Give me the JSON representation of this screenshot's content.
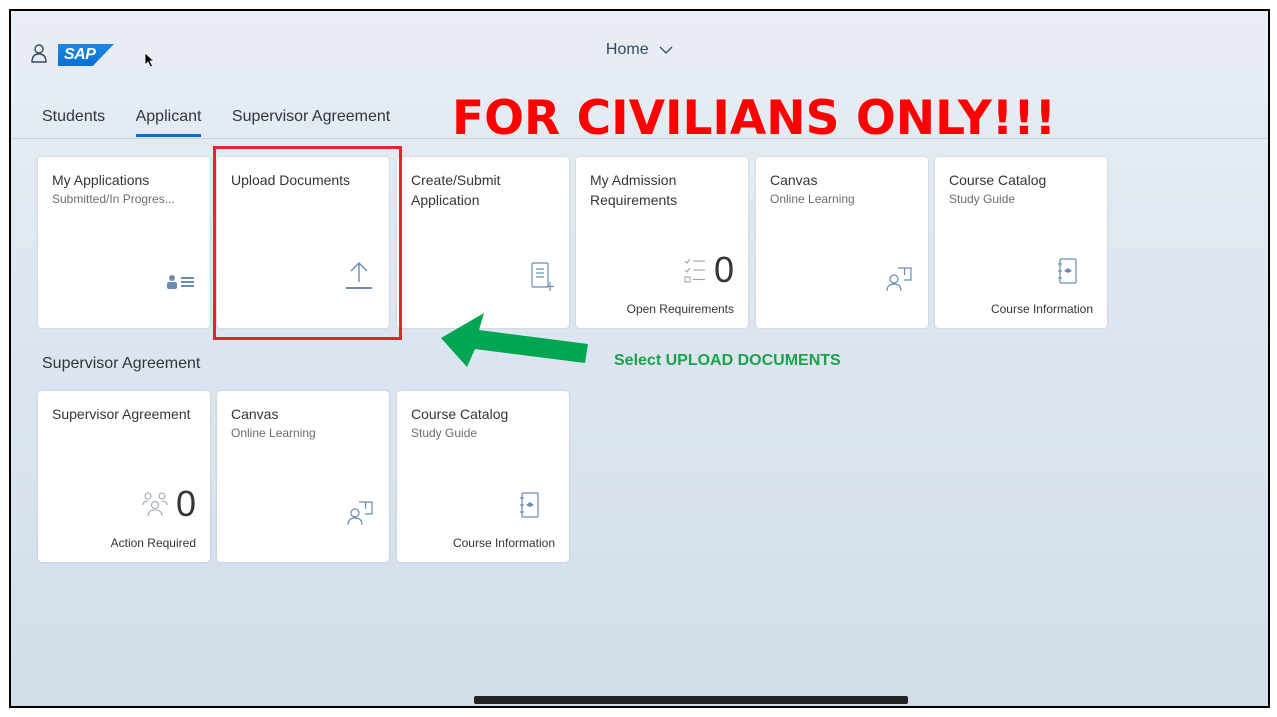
{
  "shell": {
    "home_label": "Home",
    "logo_text": "SAP"
  },
  "tabs": [
    {
      "label": "Students",
      "active": false
    },
    {
      "label": "Applicant",
      "active": true
    },
    {
      "label": "Supervisor Agreement",
      "active": false
    }
  ],
  "banner": {
    "text": "FOR CIVILIANS ONLY!!!",
    "color": "#ff0000"
  },
  "applicant_tiles": [
    {
      "title": "My Applications",
      "subtitle": "Submitted/In Progres...",
      "icon": "applicant-icon"
    },
    {
      "title": "Upload Documents",
      "subtitle": "",
      "icon": "upload-icon"
    },
    {
      "title": "Create/Submit Application",
      "subtitle": "",
      "icon": "add-document-icon"
    },
    {
      "title": "My Admission Requirements",
      "subtitle": "",
      "kpi": "0",
      "footer": "Open Requirements",
      "icon": "checklist-icon"
    },
    {
      "title": "Canvas",
      "subtitle": "Online Learning",
      "icon": "learning-icon"
    },
    {
      "title": "Course Catalog",
      "subtitle": "Study Guide",
      "footer": "Course Information",
      "icon": "course-book-icon"
    }
  ],
  "supervisor_section": {
    "title": "Supervisor Agreement",
    "tiles": [
      {
        "title": "Supervisor Agreement",
        "kpi": "0",
        "footer": "Action Required",
        "icon": "group-icon"
      },
      {
        "title": "Canvas",
        "subtitle": "Online Learning",
        "icon": "learning-icon"
      },
      {
        "title": "Course Catalog",
        "subtitle": "Study Guide",
        "footer": "Course Information",
        "icon": "course-book-icon"
      }
    ]
  },
  "annotation": {
    "instruction": "Select UPLOAD DOCUMENTS",
    "instruction_color": "#1aa34a",
    "highlight_color": "#e8222b"
  },
  "colors": {
    "accent": "#0a6ed1",
    "icon": "#6a8caf"
  }
}
